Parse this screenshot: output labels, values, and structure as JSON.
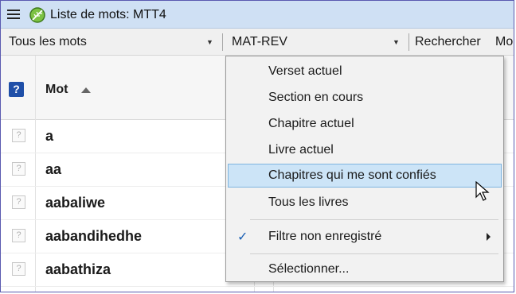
{
  "window": {
    "title": "Liste de mots: MTT4"
  },
  "filter_bar": {
    "word_filter": "Tous les mots",
    "scope_filter": "MAT-REV",
    "search_label": "Rechercher",
    "truncated_label": "Mo"
  },
  "table": {
    "help_icon_text": "?",
    "column_word": "Mot",
    "rows": [
      {
        "icon": "?",
        "word": "a"
      },
      {
        "icon": "?",
        "word": "aa"
      },
      {
        "icon": "?",
        "word": "aabaliwe"
      },
      {
        "icon": "?",
        "word": "aabandihedhe"
      },
      {
        "icon": "?",
        "word": "aabathiza"
      }
    ]
  },
  "menu": {
    "items": [
      {
        "label": "Verset actuel"
      },
      {
        "label": "Section en cours"
      },
      {
        "label": "Chapitre actuel"
      },
      {
        "label": "Livre actuel"
      },
      {
        "label": "Chapitres qui me sont confiés",
        "highlighted": true
      },
      {
        "label": "Tous les livres"
      },
      {
        "label": "Filtre non enregistré",
        "checked": true,
        "check_mark": "✓",
        "has_submenu": true
      },
      {
        "label": "Sélectionner..."
      }
    ]
  },
  "colors": {
    "title_bar": "#cfe0f4",
    "highlight": "#cce4f7",
    "help_icon": "#1f4fa8",
    "leaf": "#6db33f"
  }
}
